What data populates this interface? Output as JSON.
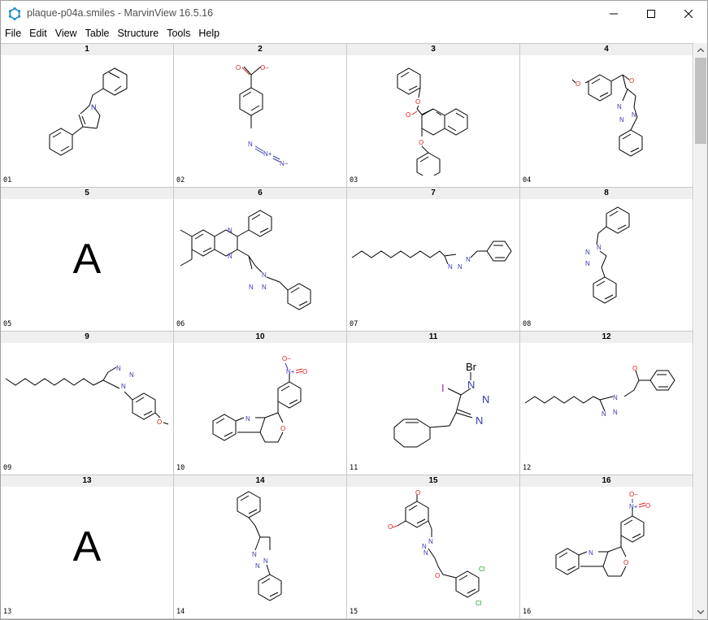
{
  "window": {
    "title": "plaque-p04a.smiles - MarvinView 16.5.16"
  },
  "menu": [
    "File",
    "Edit",
    "View",
    "Table",
    "Structure",
    "Tools",
    "Help"
  ],
  "cells": [
    {
      "num": "1",
      "id": "01"
    },
    {
      "num": "2",
      "id": "02"
    },
    {
      "num": "3",
      "id": "03"
    },
    {
      "num": "4",
      "id": "04"
    },
    {
      "num": "5",
      "id": "05",
      "letter": "A"
    },
    {
      "num": "6",
      "id": "06"
    },
    {
      "num": "7",
      "id": "07"
    },
    {
      "num": "8",
      "id": "08"
    },
    {
      "num": "9",
      "id": "09"
    },
    {
      "num": "10",
      "id": "10"
    },
    {
      "num": "11",
      "id": "11"
    },
    {
      "num": "12",
      "id": "12"
    },
    {
      "num": "13",
      "id": "13",
      "letter": "A"
    },
    {
      "num": "14",
      "id": "14"
    },
    {
      "num": "15",
      "id": "15"
    },
    {
      "num": "16",
      "id": "16"
    }
  ],
  "atoms": {
    "N": "N",
    "O": "O",
    "Br": "Br",
    "I": "I",
    "Cl": "Cl",
    "N_plus": "N+",
    "N_minus": "N−",
    "O_minus": "O−"
  },
  "colors": {
    "nitrogen": "#3838b0",
    "oxygen": "#e02020",
    "chlorine": "#20a020",
    "bond": "#000000"
  }
}
